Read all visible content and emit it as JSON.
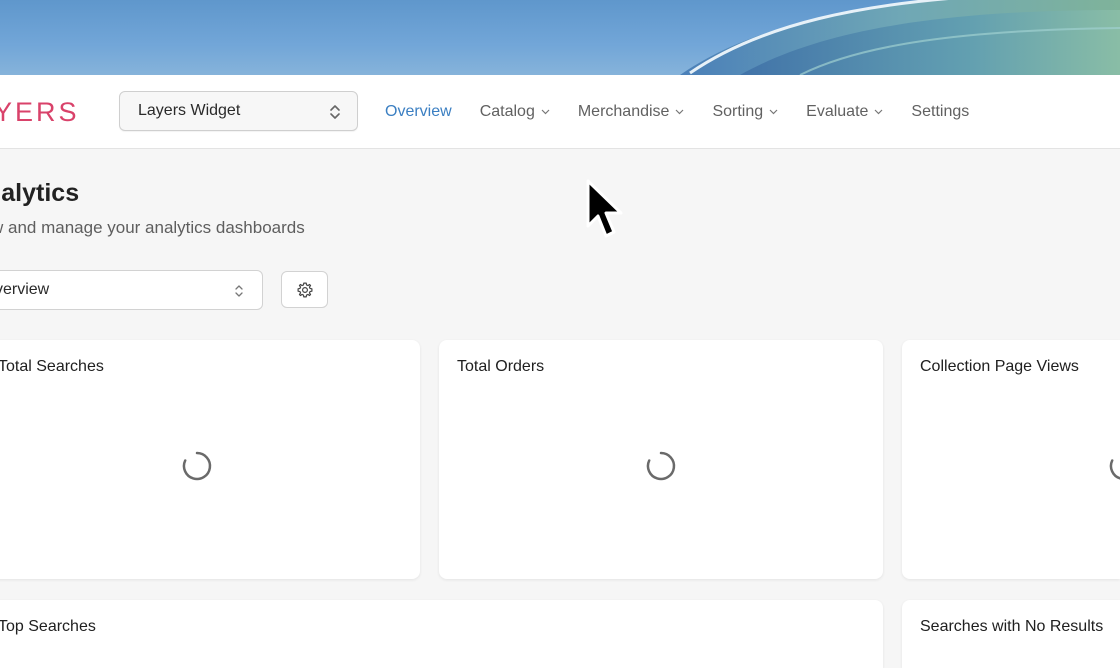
{
  "header": {
    "logo_text": "YERS",
    "store_select": {
      "value": "Layers Widget"
    },
    "nav": [
      {
        "label": "Overview",
        "active": true,
        "dropdown": false
      },
      {
        "label": "Catalog",
        "active": false,
        "dropdown": true
      },
      {
        "label": "Merchandise",
        "active": false,
        "dropdown": true
      },
      {
        "label": "Sorting",
        "active": false,
        "dropdown": true
      },
      {
        "label": "Evaluate",
        "active": false,
        "dropdown": true
      },
      {
        "label": "Settings",
        "active": false,
        "dropdown": false
      }
    ]
  },
  "page": {
    "title": "nalytics",
    "subtitle": "w and manage your analytics dashboards"
  },
  "dashboard_select": {
    "value": "verview"
  },
  "cards": {
    "total_searches": "Total Searches",
    "total_orders": "Total Orders",
    "collection_page_views": "Collection Page Views",
    "top_searches": "Top Searches",
    "searches_no_results": "Searches with No Results"
  },
  "colors": {
    "accent": "#3b7fc2",
    "logo": "#d9426a"
  },
  "icons": {
    "store_select_chevron": "chevron-up-down-icon",
    "nav_caret": "chevron-down-icon",
    "settings": "gear-icon",
    "loading": "spinner-icon",
    "cursor": "mouse-pointer-icon"
  }
}
